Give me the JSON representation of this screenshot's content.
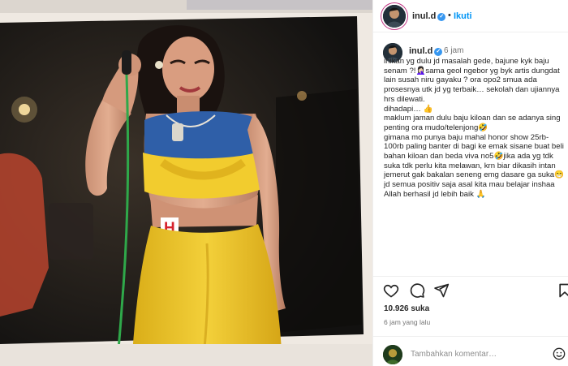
{
  "post_header": {
    "username": "inul.d",
    "separator": "•",
    "follow_label": "Ikuti"
  },
  "caption": {
    "username": "inul.d",
    "time": "6 jam",
    "text": "inikan yg dulu jd masalah gede, bajune kyk baju senam ?!🤦🏻‍♀️sama geol ngebor yg byk artis dungdat lain susah niru gayaku ? ora opo2 smua ada prosesnya utk jd yg terbaik… sekolah dan ujiannya hrs dilewati.\ndihadapi… 👍\nmaklum jaman dulu baju kiloan dan se adanya sing penting ora mudo/telenjong🤣\ngimana mo punya baju mahal honor show 25rb-100rb paling banter di bagi ke emak sisane buat beli bahan kiloan dan beda viva no5🤣jika ada yg tdk suka tdk perlu kita melawan, krn biar dikasih intan jemerut gak bakalan seneng emg dasare ga suka😁\njd semua positiv saja asal kita mau belajar inshaa Allah berhasil jd lebih baik 🙏"
  },
  "actions": {
    "icons": [
      "heart-icon",
      "comment-icon",
      "share-icon",
      "bookmark-icon"
    ],
    "likes": "10.926 suka",
    "posted_ago": "6 jam yang lalu"
  },
  "comment_box": {
    "placeholder": "Tambahkan komentar…"
  },
  "photo": {
    "letter": "H"
  },
  "colors": {
    "follow_blue": "#0095f6",
    "verified_blue": "#3797f0",
    "outfit_yellow": "#f2cc2e",
    "outfit_blue": "#2f5fa8",
    "stage_dark": "#1b1a17"
  }
}
